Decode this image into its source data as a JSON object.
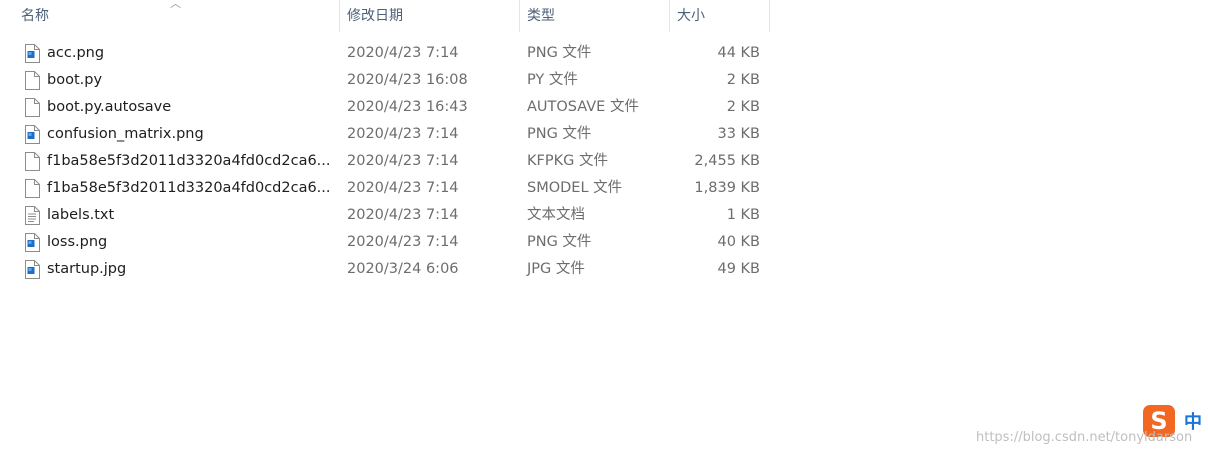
{
  "columns": {
    "name": "名称",
    "date": "修改日期",
    "type": "类型",
    "size": "大小"
  },
  "files": [
    {
      "name": "acc.png",
      "date": "2020/4/23 7:14",
      "type": "PNG 文件",
      "size": "44 KB",
      "icon": "image-file-icon"
    },
    {
      "name": "boot.py",
      "date": "2020/4/23 16:08",
      "type": "PY 文件",
      "size": "2 KB",
      "icon": "blank-file-icon"
    },
    {
      "name": "boot.py.autosave",
      "date": "2020/4/23 16:43",
      "type": "AUTOSAVE 文件",
      "size": "2 KB",
      "icon": "blank-file-icon"
    },
    {
      "name": "confusion_matrix.png",
      "date": "2020/4/23 7:14",
      "type": "PNG 文件",
      "size": "33 KB",
      "icon": "image-file-icon"
    },
    {
      "name": "f1ba58e5f3d2011d3320a4fd0cd2ca6...",
      "date": "2020/4/23 7:14",
      "type": "KFPKG 文件",
      "size": "2,455 KB",
      "icon": "blank-file-icon"
    },
    {
      "name": "f1ba58e5f3d2011d3320a4fd0cd2ca6...",
      "date": "2020/4/23 7:14",
      "type": "SMODEL 文件",
      "size": "1,839 KB",
      "icon": "blank-file-icon"
    },
    {
      "name": "labels.txt",
      "date": "2020/4/23 7:14",
      "type": "文本文档",
      "size": "1 KB",
      "icon": "text-file-icon"
    },
    {
      "name": "loss.png",
      "date": "2020/4/23 7:14",
      "type": "PNG 文件",
      "size": "40 KB",
      "icon": "image-file-icon"
    },
    {
      "name": "startup.jpg",
      "date": "2020/3/24 6:06",
      "type": "JPG 文件",
      "size": "49 KB",
      "icon": "image-file-icon"
    }
  ],
  "ime": {
    "logo": "S",
    "mode": "中"
  },
  "watermark": "https://blog.csdn.net/tonyldarson",
  "colors": {
    "header_text": "#4c607a",
    "row_text": "#1e1e1e",
    "meta_text": "#6d6d6d",
    "sogou_orange": "#f26722",
    "ime_blue": "#1a73d9"
  }
}
